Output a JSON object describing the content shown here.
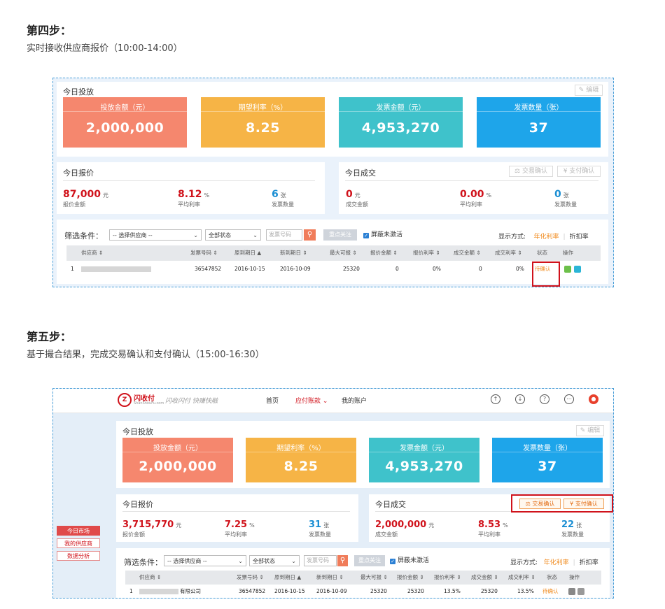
{
  "step4": {
    "title": "第四步：",
    "subtitle": "实时接收供应商报价（10:00-14:00）",
    "invest": {
      "title": "今日投放",
      "edit_label": "编辑",
      "cards": [
        {
          "label": "投放金额（元）",
          "value": "2,000,000",
          "color": "#f5876e"
        },
        {
          "label": "期望利率（%）",
          "value": "8.25",
          "color": "#f6b446"
        },
        {
          "label": "发票金额（元）",
          "value": "4,953,270",
          "color": "#3fc2cb"
        },
        {
          "label": "发票数量（张）",
          "value": "37",
          "color": "#1ea5ea"
        }
      ]
    },
    "quote": {
      "title": "今日报价",
      "metrics": [
        {
          "num": "87,000",
          "unit": "元",
          "cap": "报价金额"
        },
        {
          "num": "8.12",
          "unit": "%",
          "cap": "平均利率"
        },
        {
          "num": "6",
          "unit": "张",
          "cap": "发票数量"
        }
      ]
    },
    "deal": {
      "title": "今日成交",
      "trade_confirm": "交易确认",
      "pay_confirm": "支付确认",
      "metrics": [
        {
          "num": "0",
          "unit": "元",
          "cap": "成交金额"
        },
        {
          "num": "0.00",
          "unit": "%",
          "cap": "平均利率"
        },
        {
          "num": "0",
          "unit": "张",
          "cap": "发票数量"
        }
      ]
    },
    "filter": {
      "label": "筛选条件：",
      "supplier_select": "-- 选择供应商 --",
      "status_select": "全部状态",
      "invoice_placeholder": "发票号码",
      "focus_button": "重点关注",
      "mask_checkbox": "屏蔽未激活",
      "display_label": "显示方式:",
      "display_annual": "年化利率",
      "display_discount": "折扣率"
    },
    "table": {
      "headers": [
        "供应商",
        "发票号码",
        "原到期日",
        "新到期日",
        "最大可报",
        "报价金额",
        "报价利率",
        "成交金额",
        "成交利率",
        "状态",
        "操作"
      ],
      "rows": [
        {
          "index": "1",
          "supplier": "",
          "invoice_no": "36547852",
          "orig_due": "2016-10-15",
          "new_due": "2016-10-09",
          "max": "25320",
          "quote_amt": "0",
          "quote_rate": "0%",
          "deal_amt": "0",
          "deal_rate": "0%",
          "status": "待确认"
        }
      ]
    }
  },
  "step5": {
    "title": "第五步：",
    "subtitle": "基于撮合结果，完成交易确认和支付确认（15:00-16:30）",
    "brand": {
      "logo_text": "闪收付",
      "logo_sub": "ShanShouFu.com",
      "slogan": "闪收闪付 快赚快融"
    },
    "nav": [
      "首页",
      "应付账款",
      "我的账户"
    ],
    "sidebar": [
      "今日市场",
      "我的供应商",
      "数据分析"
    ],
    "invest": {
      "title": "今日投放",
      "edit_label": "编辑",
      "cards": [
        {
          "label": "投放金额（元）",
          "value": "2,000,000",
          "color": "#f5876e"
        },
        {
          "label": "期望利率（%）",
          "value": "8.25",
          "color": "#f6b446"
        },
        {
          "label": "发票金额（元）",
          "value": "4,953,270",
          "color": "#3fc2cb"
        },
        {
          "label": "发票数量（张）",
          "value": "37",
          "color": "#1ea5ea"
        }
      ]
    },
    "quote": {
      "title": "今日报价",
      "metrics": [
        {
          "num": "3,715,770",
          "unit": "元",
          "cap": "报价金额"
        },
        {
          "num": "7.25",
          "unit": "%",
          "cap": "平均利率"
        },
        {
          "num": "31",
          "unit": "张",
          "cap": "发票数量"
        }
      ]
    },
    "deal": {
      "title": "今日成交",
      "trade_confirm": "交易确认",
      "pay_confirm": "支付确认",
      "metrics": [
        {
          "num": "2,000,000",
          "unit": "元",
          "cap": "成交金额"
        },
        {
          "num": "8.53",
          "unit": "%",
          "cap": "平均利率"
        },
        {
          "num": "22",
          "unit": "张",
          "cap": "发票数量"
        }
      ]
    },
    "filter": {
      "label": "筛选条件：",
      "supplier_select": "-- 选择供应商 --",
      "status_select": "全部状态",
      "invoice_placeholder": "发票号码",
      "focus_button": "重点关注",
      "mask_checkbox": "屏蔽未激活",
      "display_label": "显示方式:",
      "display_annual": "年化利率",
      "display_discount": "折扣率"
    },
    "table": {
      "headers": [
        "供应商",
        "发票号码",
        "原到期日",
        "新到期日",
        "最大可报",
        "报价金额",
        "报价利率",
        "成交金额",
        "成交利率",
        "状态",
        "操作"
      ],
      "rows": [
        {
          "index": "1",
          "supplier": "有限公司",
          "invoice_no": "36547852",
          "orig_due": "2016-10-15",
          "new_due": "2016-10-09",
          "max": "25320",
          "quote_amt": "25320",
          "quote_rate": "13.5%",
          "deal_amt": "25320",
          "deal_rate": "13.5%",
          "status": "待确认"
        }
      ]
    }
  }
}
